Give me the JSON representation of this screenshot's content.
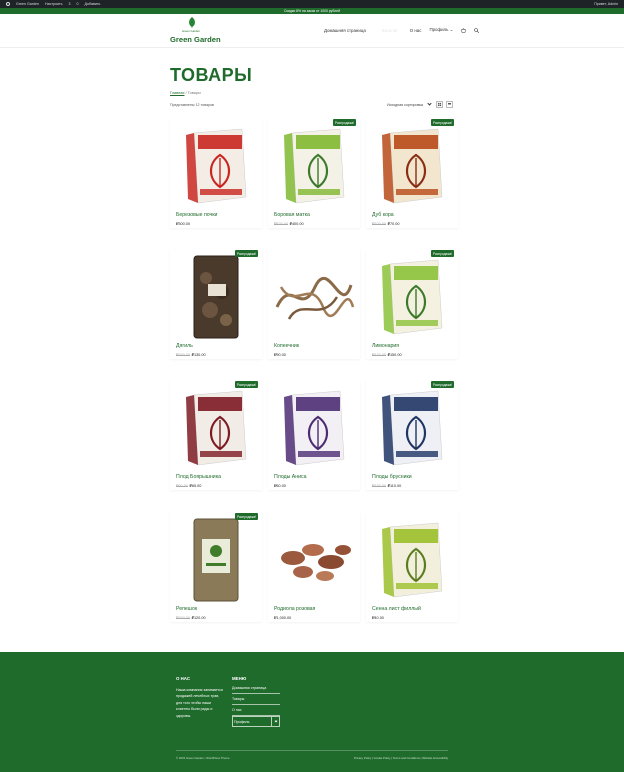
{
  "admin_bar": {
    "site_name": "Green Garden",
    "customize": "Настроить",
    "updates": "3",
    "comments": "0",
    "new": "Добавить",
    "greeting": "Привет, Admin"
  },
  "notice": "Скидки 8% на заказ от 1000 рублей",
  "header": {
    "logo_small": "Green Garden",
    "logo_name": "Green Garden",
    "nav": {
      "home": "Домашняя страница",
      "ghost": "Каталог",
      "about": "О нас",
      "profile": "Профиль"
    }
  },
  "colors": {
    "brand_green": "#1f6b2b",
    "admin_dark": "#1d2327"
  },
  "page": {
    "title": "ТОВАРЫ",
    "breadcrumb_home": "Главная",
    "breadcrumb_sep": " / ",
    "breadcrumb_current": "Товары",
    "result_count": "Представлены 12 товаров",
    "sort_label": "Исходная сортировка"
  },
  "products": [
    {
      "name": "Березовые почки",
      "old_price": "",
      "price": "₽300.00",
      "badge": "",
      "image": "box-red"
    },
    {
      "name": "Боровая матка",
      "old_price": "₽520.00",
      "price": "₽400.00",
      "badge": "Распродажа!",
      "image": "box-green"
    },
    {
      "name": "Дуб кора",
      "old_price": "₽100.00",
      "price": "₽70.00",
      "badge": "Распродажа!",
      "image": "box-orange"
    },
    {
      "name": "Дягиль",
      "old_price": "₽150.00",
      "price": "₽130.00",
      "badge": "Распродажа!",
      "image": "bag-dark"
    },
    {
      "name": "Копеечник",
      "old_price": "",
      "price": "₽90.00",
      "badge": "",
      "image": "roots-curly"
    },
    {
      "name": "Лимонария",
      "old_price": "₽170.00",
      "price": "₽150.00",
      "badge": "Распродажа!",
      "image": "box-lime"
    },
    {
      "name": "Плод Боярышника",
      "old_price": "₽90.00",
      "price": "₽65.00",
      "badge": "Распродажа!",
      "image": "box-maroon"
    },
    {
      "name": "Плоды Аниса",
      "old_price": "",
      "price": "₽60.00",
      "badge": "",
      "image": "box-purple"
    },
    {
      "name": "Плоды брусники",
      "old_price": "₽130.00",
      "price": "₽110.00",
      "badge": "Распродажа!",
      "image": "box-navy"
    },
    {
      "name": "Репешок",
      "old_price": "₽150.00",
      "price": "₽120.00",
      "badge": "Распродажа!",
      "image": "bag-herbs"
    },
    {
      "name": "Родиола розовая",
      "old_price": "",
      "price": "₽1,000.00",
      "badge": "",
      "image": "roots-chunks"
    },
    {
      "name": "Сенна лист филлый",
      "old_price": "",
      "price": "₽40.00",
      "badge": "",
      "image": "box-yellow"
    }
  ],
  "footer": {
    "about_heading": "О НАС",
    "about_text": "Наша компания занимается продажей лечебных трав, для того чтобы наши клиенты были рады и здоровы.",
    "menu_heading": "МЕНЮ",
    "menu_items": [
      "Домашняя страница",
      "Товары",
      "О нас",
      "Профиль"
    ],
    "copyright": "© 2023 Green Garden • WordPress Theme",
    "links": "Privacy Policy | Cookie Policy | Terms and Conditions | Website Accessibility"
  }
}
